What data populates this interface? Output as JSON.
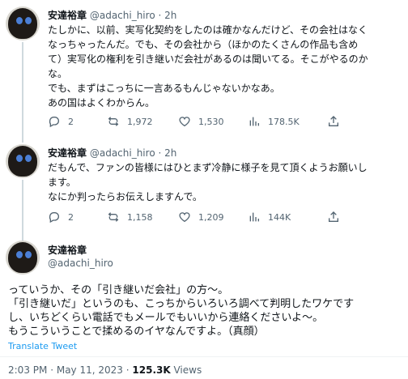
{
  "tweets": [
    {
      "name": "安達裕章",
      "handle": "@adachi_hiro",
      "dot": "·",
      "time": "2h",
      "lines": [
        "たしかに、以前、実写化契約をしたのは確かなんだけど、その会社はなく",
        "なっちゃったんだ。でも、その会社から（ほかのたくさんの作品も含め",
        "て）実写化の権利を引き継いだ会社があるのは聞いてる。そこがやるのか",
        "な。",
        "でも、まずはこっちに一言あるもんじゃないかなあ。",
        "あの国はよくわからん。"
      ],
      "replies": "2",
      "retweets": "1,972",
      "likes": "1,530",
      "views": "178.5K"
    },
    {
      "name": "安達裕章",
      "handle": "@adachi_hiro",
      "dot": "·",
      "time": "2h",
      "lines": [
        "だもんで、ファンの皆様にはひとまず冷静に様子を見て頂くようお願いし",
        "ます。",
        "なにか判ったらお伝えしますんで。"
      ],
      "replies": "2",
      "retweets": "1,158",
      "likes": "1,209",
      "views": "144K"
    }
  ],
  "main": {
    "name": "安達裕章",
    "handle": "@adachi_hiro",
    "lines": [
      "っていうか、その「引き継いだ会社」の方〜。",
      "「引き継いだ」というのも、こっちからいろいろ調べて判明したワケです",
      "し、いちどくらい電話でもメールでもいいから連絡くださいよ〜。",
      "もうこういうことで揉めるのイヤなんですよ。（真顔）"
    ],
    "translate": "Translate Tweet",
    "time": "2:03 PM",
    "sep": "·",
    "date": "May 11, 2023",
    "views_count": "125.3K",
    "views_label": "Views"
  },
  "icons": [
    "reply-icon",
    "retweet-icon",
    "like-icon",
    "views-icon",
    "share-icon"
  ],
  "colors": {
    "link": "#1d9bf0",
    "secondary": "#536471",
    "text": "#0f1419",
    "thread": "#cfd9de"
  }
}
